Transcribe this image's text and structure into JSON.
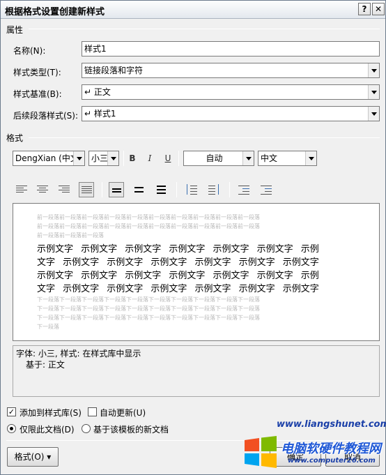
{
  "window": {
    "title": "根据格式设置创建新样式",
    "help": "?",
    "close": "✕"
  },
  "properties": {
    "section": "属性",
    "name_label": "名称(N):",
    "name_value": "样式1",
    "type_label": "样式类型(T):",
    "type_value": "链接段落和字符",
    "based_label": "样式基准(B):",
    "based_value": "↵ 正文",
    "next_label": "后续段落样式(S):",
    "next_value": "↵ 样式1"
  },
  "format": {
    "section": "格式",
    "font": "DengXian (中文",
    "size": "小三",
    "bold": "B",
    "italic": "I",
    "underline": "U",
    "color": "自动",
    "script": "中文"
  },
  "preview": {
    "prev_line": "前一段落前一段落前一段落前一段落前一段落前一段落前一段落前一段落前一段落前一段落",
    "prev_last": "前一段落前一段落前一段落",
    "sample_lines": [
      "示例文字 示例文字 示例文字 示例文字 示例文字 示例文字 示例",
      "文字 示例文字 示例文字 示例文字 示例文字 示例文字 示例文字",
      "示例文字 示例文字 示例文字 示例文字 示例文字 示例文字 示例",
      "文字 示例文字 示例文字 示例文字 示例文字 示例文字 示例文字"
    ],
    "next_line": "下一段落下一段落下一段落下一段落下一段落下一段落下一段落下一段落下一段落下一段落",
    "next_last": "下一段落"
  },
  "description": {
    "line1": "字体: 小三, 样式: 在样式库中显示",
    "line2": "基于: 正文"
  },
  "options": {
    "add_gallery": "添加到样式库(S)",
    "auto_update": "自动更新(U)",
    "this_doc": "仅限此文档(D)",
    "template": "基于该模板的新文档"
  },
  "buttons": {
    "format": "格式(O) ▾",
    "ok": "确定",
    "cancel": "取消"
  },
  "watermark": {
    "site": "www.liangshunet.com",
    "name": "电脑软硬件教程网",
    "url": "www.computer26.com"
  },
  "colors": {
    "title_bg": "#e3e8ee",
    "window_bg": "#f0f0f0"
  }
}
